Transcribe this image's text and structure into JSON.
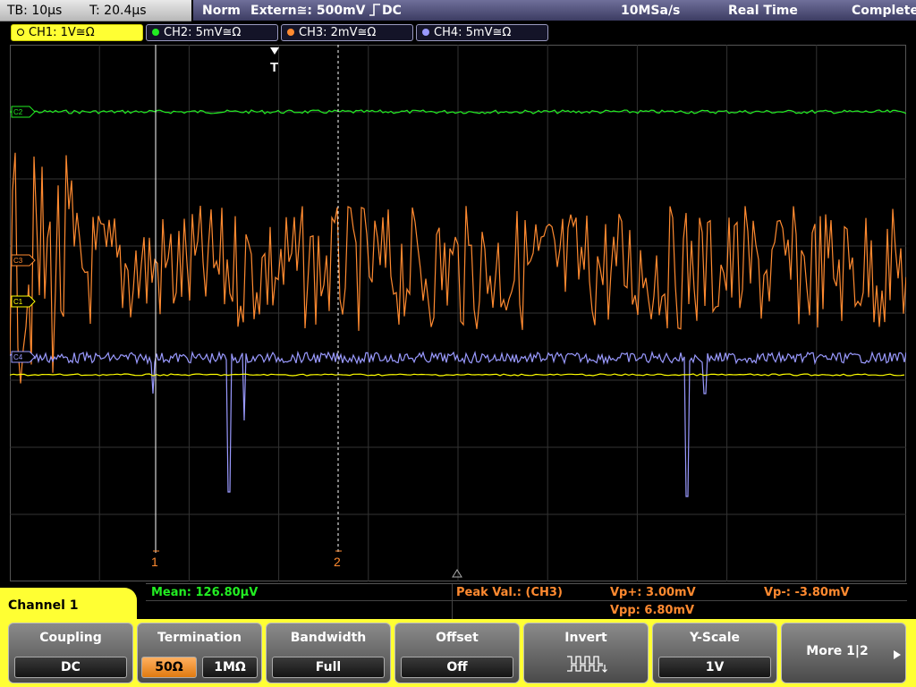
{
  "status": {
    "timebase": "TB: 10µs",
    "trigger_time": "T: 20.4µs",
    "mode": "Norm",
    "trigger_source": "Extern≅: 500mV",
    "trigger_coupling": "DC",
    "sample_rate": "10MSa/s",
    "acquisition": "Real Time",
    "state": "Complete"
  },
  "channels": [
    {
      "label": "CH1: 1V≅Ω",
      "color": "#ffff00"
    },
    {
      "label": "CH2: 5mV≅Ω",
      "color": "#22ee22"
    },
    {
      "label": "CH3: 2mV≅Ω",
      "color": "#ff8a30"
    },
    {
      "label": "CH4: 5mV≅Ω",
      "color": "#9a9aff"
    }
  ],
  "screen": {
    "trigger_marker": "T",
    "cursor1": "1",
    "cursor2": "2",
    "ref_labels": [
      "C2",
      "C3",
      "C1",
      "C4"
    ]
  },
  "measurement": {
    "mean": "Mean: 126.80µV",
    "peak_label": "Peak Val.:  (CH3)",
    "vp_plus": "Vp+: 3.00mV",
    "vp_minus": "Vp-: -3.80mV",
    "vpp": "Vpp: 6.80mV"
  },
  "menu_title": "Channel 1",
  "softkeys": {
    "coupling": {
      "title": "Coupling",
      "value": "DC"
    },
    "termination": {
      "title": "Termination",
      "opt1": "50Ω",
      "opt2": "1MΩ"
    },
    "bandwidth": {
      "title": "Bandwidth",
      "value": "Full"
    },
    "offset": {
      "title": "Offset",
      "value": "Off"
    },
    "invert": {
      "title": "Invert"
    },
    "yscale": {
      "title": "Y-Scale",
      "value": "1V"
    },
    "more": {
      "label": "More 1|2"
    }
  },
  "colors": {
    "ch1": "#ffff00",
    "ch2": "#22ee22",
    "ch3": "#ff8a30",
    "ch4": "#9a9aff",
    "accent": "#ffff33"
  }
}
